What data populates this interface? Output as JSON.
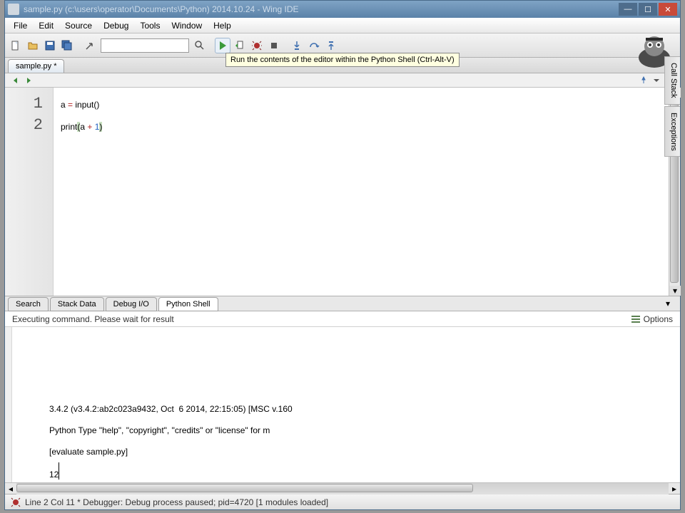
{
  "window": {
    "title": "sample.py (c:\\users\\operator\\Documents\\Python) 2014.10.24 - Wing IDE"
  },
  "menu": {
    "file": "File",
    "edit": "Edit",
    "source": "Source",
    "debug": "Debug",
    "tools": "Tools",
    "window": "Window",
    "help": "Help"
  },
  "tooltip": "Run the contents of the editor within the Python Shell (Ctrl-Alt-V)",
  "tabs": {
    "editor": "sample.py *"
  },
  "code": {
    "lines": [
      "1",
      "2"
    ],
    "l1_a": "a ",
    "l1_eq": "= ",
    "l1_fn": "input",
    "l1_p": "()",
    "l2_fn": "print",
    "l2_op": "(",
    "l2_a": "a ",
    "l2_plus": "+ ",
    "l2_num": "1",
    "l2_cp": ")"
  },
  "right_tabs": {
    "call": "Call Stack",
    "exc": "Exceptions"
  },
  "bottom_tabs": {
    "search": "Search",
    "stack": "Stack Data",
    "debugio": "Debug I/O",
    "shell": "Python Shell"
  },
  "shell_header": {
    "msg": "Executing command.  Please wait for result",
    "options": "Options"
  },
  "shell": {
    "line1": "3.4.2 (v3.4.2:ab2c023a9432, Oct  6 2014, 22:15:05) [MSC v.160",
    "line2": "Python Type \"help\", \"copyright\", \"credits\" or \"license\" for m",
    "line3": "[evaluate sample.py]",
    "line4": "12"
  },
  "status": {
    "text": "Line 2 Col 11 * Debugger: Debug process paused; pid=4720 [1 modules loaded]"
  }
}
